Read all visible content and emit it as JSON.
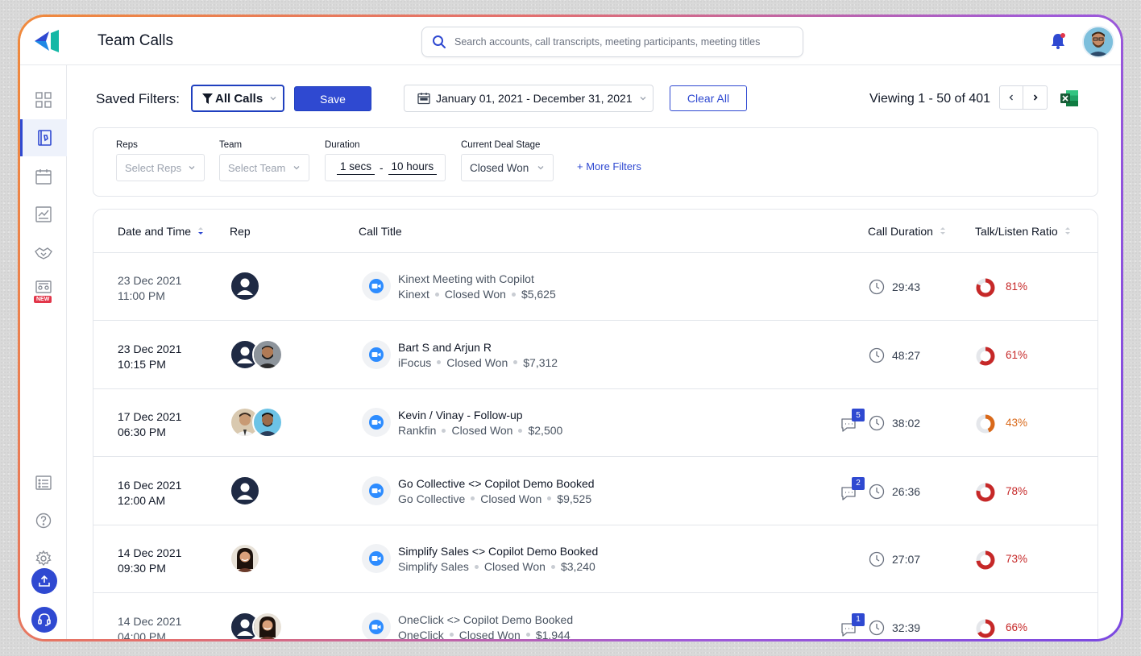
{
  "app": {
    "title": "Team Calls"
  },
  "search": {
    "placeholder": "Search accounts, call transcripts, meeting participants, meeting titles"
  },
  "toolbar": {
    "saved_filters_label": "Saved Filters:",
    "saved_filter_value": "All Calls",
    "save_label": "Save",
    "date_range": "January 01, 2021 - December 31, 2021",
    "clear_all_label": "Clear All",
    "viewing": "Viewing 1 - 50 of 401"
  },
  "filters": {
    "reps": {
      "label": "Reps",
      "placeholder": "Select Reps"
    },
    "team": {
      "label": "Team",
      "placeholder": "Select Team"
    },
    "duration": {
      "label": "Duration",
      "min": "1 secs",
      "separator": "-",
      "max": "10 hours"
    },
    "deal_stage": {
      "label": "Current Deal Stage",
      "value": "Closed Won"
    },
    "more_filters": "+ More Filters"
  },
  "sidebar": {
    "new_badge": "NEW"
  },
  "table": {
    "columns": {
      "date_time": "Date and Time",
      "rep": "Rep",
      "call_title": "Call Title",
      "call_duration": "Call Duration",
      "talk_listen": "Talk/Listen Ratio"
    },
    "rows": [
      {
        "date": "23 Dec 2021",
        "time": "11:00 PM",
        "title": "Kinext Meeting with Copilot",
        "company": "Kinext",
        "stage": "Closed Won",
        "amount": "$5,625",
        "comments": "",
        "duration": "29:43",
        "ratio": "81%",
        "ratio_value": 0.81,
        "color": "#c62828"
      },
      {
        "date": "23 Dec 2021",
        "time": "10:15 PM",
        "title": "Bart S and Arjun R",
        "company": "iFocus",
        "stage": "Closed Won",
        "amount": "$7,312",
        "comments": "",
        "duration": "48:27",
        "ratio": "61%",
        "ratio_value": 0.61,
        "color": "#c62828"
      },
      {
        "date": "17 Dec 2021",
        "time": "06:30 PM",
        "title": "Kevin / Vinay - Follow-up",
        "company": "Rankfin",
        "stage": "Closed Won",
        "amount": "$2,500",
        "comments": "5",
        "duration": "38:02",
        "ratio": "43%",
        "ratio_value": 0.43,
        "color": "#d9691a"
      },
      {
        "date": "16 Dec 2021",
        "time": "12:00 AM",
        "title": "Go Collective <> Copilot Demo Booked",
        "company": "Go Collective",
        "stage": "Closed Won",
        "amount": "$9,525",
        "comments": "2",
        "duration": "26:36",
        "ratio": "78%",
        "ratio_value": 0.78,
        "color": "#c62828"
      },
      {
        "date": "14 Dec 2021",
        "time": "09:30 PM",
        "title": "Simplify Sales <> Copilot Demo Booked",
        "company": "Simplify Sales",
        "stage": "Closed Won",
        "amount": "$3,240",
        "comments": "",
        "duration": "27:07",
        "ratio": "73%",
        "ratio_value": 0.73,
        "color": "#c62828"
      },
      {
        "date": "14 Dec 2021",
        "time": "04:00 PM",
        "title": "OneClick <> Copilot Demo Booked",
        "company": "OneClick",
        "stage": "Closed Won",
        "amount": "$1,944",
        "comments": "1",
        "duration": "32:39",
        "ratio": "66%",
        "ratio_value": 0.66,
        "color": "#c62828"
      }
    ]
  }
}
